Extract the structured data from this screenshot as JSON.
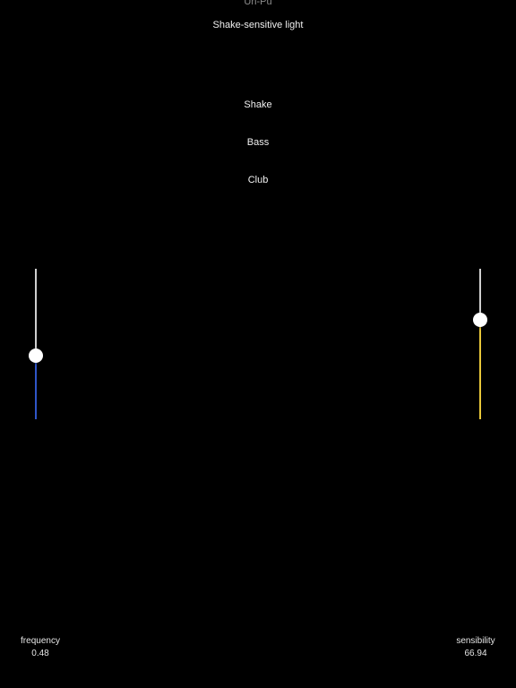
{
  "header": {
    "partial_text": "Un-Pu",
    "title": "Shake-sensitive light"
  },
  "modes": {
    "shake": "Shake",
    "bass": "Bass",
    "club": "Club"
  },
  "frequency": {
    "label": "frequency",
    "value": "0.48",
    "level": 0.42,
    "fill_color": "#2f56c8"
  },
  "sensibility": {
    "label": "sensibility",
    "value": "66.94",
    "level": 0.66,
    "fill_color": "#e9c83a"
  },
  "colors": {
    "background": "#000000",
    "wave_gradient": [
      "#d22a1a",
      "#e06a1a",
      "#d8a020",
      "#9ac020",
      "#4aa030",
      "#209070",
      "#2060b0",
      "#3040c0",
      "#6a2a8a"
    ]
  }
}
